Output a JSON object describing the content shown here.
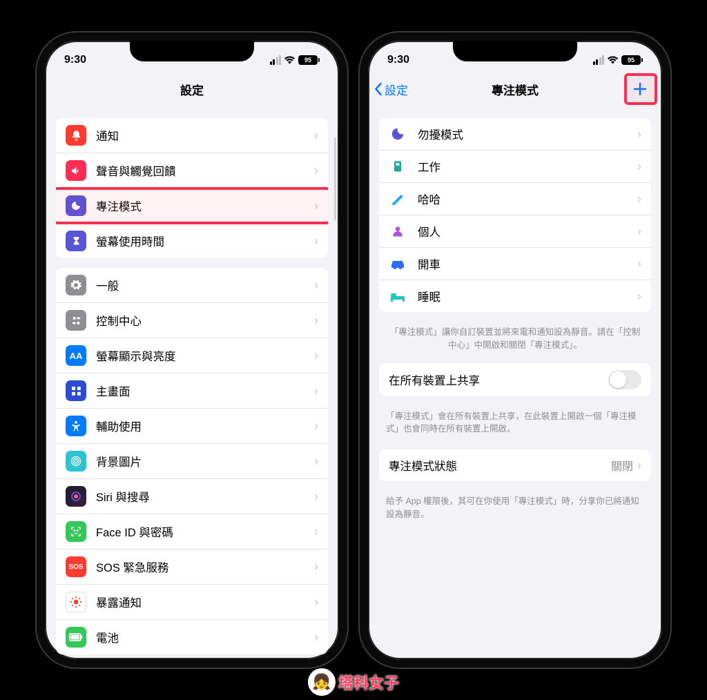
{
  "status": {
    "time": "9:30",
    "battery": "95"
  },
  "left": {
    "title": "設定",
    "group1": [
      {
        "icon": "bell-icon",
        "bg": "#ff3b30",
        "glyph": "🔔",
        "label": "通知"
      },
      {
        "icon": "sound-icon",
        "bg": "#ff2d55",
        "glyph": "🔊",
        "label": "聲音與觸覺回饋"
      },
      {
        "icon": "moon-icon",
        "bg": "#5856d6",
        "glyph": "🌙",
        "label": "專注模式"
      },
      {
        "icon": "hourglass-icon",
        "bg": "#5856d6",
        "glyph": "⏳",
        "label": "螢幕使用時間"
      }
    ],
    "group2": [
      {
        "icon": "gear-icon",
        "bg": "#8e8e93",
        "glyph": "⚙️",
        "label": "一般"
      },
      {
        "icon": "control-icon",
        "bg": "#8e8e93",
        "glyph": "🎛",
        "label": "控制中心"
      },
      {
        "icon": "display-icon",
        "bg": "#007aff",
        "glyph": "AA",
        "label": "螢幕顯示與亮度"
      },
      {
        "icon": "home-icon",
        "bg": "#3355dd",
        "glyph": "▦",
        "label": "主畫面"
      },
      {
        "icon": "accessibility-icon",
        "bg": "#007aff",
        "glyph": "♿︎",
        "label": "輔助使用"
      },
      {
        "icon": "wallpaper-icon",
        "bg": "#34c7c0",
        "glyph": "❀",
        "label": "背景圖片"
      },
      {
        "icon": "siri-icon",
        "bg": "#1c1c1e",
        "glyph": "◉",
        "label": "Siri 與搜尋"
      },
      {
        "icon": "faceid-icon",
        "bg": "#34c759",
        "glyph": "😃",
        "label": "Face ID 與密碼"
      },
      {
        "icon": "sos-icon",
        "bg": "#ff3b30",
        "glyph": "SOS",
        "label": "SOS 緊急服務"
      },
      {
        "icon": "exposure-icon",
        "bg": "#ffffff",
        "glyph": "✺",
        "label": "暴露通知",
        "fg": "#ff3b30"
      },
      {
        "icon": "battery-icon",
        "bg": "#34c759",
        "glyph": "▮",
        "label": "電池"
      }
    ]
  },
  "right": {
    "back": "設定",
    "title": "專注模式",
    "modes": [
      {
        "icon": "moon-icon",
        "color": "#5856d6",
        "glyph": "☾",
        "label": "勿擾模式"
      },
      {
        "icon": "badge-icon",
        "color": "#18aaa0",
        "glyph": "🪪",
        "label": "工作"
      },
      {
        "icon": "pencil-icon",
        "color": "#2aa7ef",
        "glyph": "✎",
        "label": "哈哈"
      },
      {
        "icon": "person-icon",
        "color": "#af52de",
        "glyph": "👤",
        "label": "個人"
      },
      {
        "icon": "car-icon",
        "color": "#2a6df4",
        "glyph": "🚗",
        "label": "開車"
      },
      {
        "icon": "bed-icon",
        "color": "#20c7bd",
        "glyph": "🛏",
        "label": "睡眠"
      }
    ],
    "footer1": "「專注模式」讓你自訂裝置並將來電和通知設為靜音。請在「控制中心」中開啟和關閉「專注模式」。",
    "share": {
      "label": "在所有裝置上共享"
    },
    "footer2": "「專注模式」會在所有裝置上共享，在此裝置上開啟一個「專注模式」也會同時在所有裝置上開啟。",
    "status": {
      "label": "專注模式狀態",
      "value": "關閉"
    },
    "footer3": "給予 App 權限後，其可在你使用「專注模式」時，分享你已將通知設為靜音。"
  },
  "watermark": "塔科女子"
}
